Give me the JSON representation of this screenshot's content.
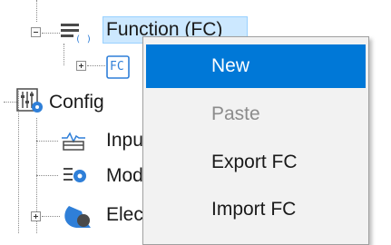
{
  "tree": {
    "function_fc": {
      "label": "Function (FC)",
      "expanded": true,
      "selected": true
    },
    "fc_child": {
      "icon_text": "FC",
      "expanded": false
    },
    "config": {
      "label": "Config",
      "expanded": true
    },
    "input_item": {
      "label": "Inpu"
    },
    "module_item": {
      "label": "Mod"
    },
    "electric_item": {
      "label": "Elec",
      "expanded": false
    }
  },
  "context_menu": {
    "items": [
      {
        "label": "New",
        "state": "highlighted"
      },
      {
        "label": "Paste",
        "state": "disabled"
      },
      {
        "label": "Export FC",
        "state": "normal"
      },
      {
        "label": "Import FC",
        "state": "normal"
      }
    ]
  },
  "colors": {
    "selection_bg": "#cce8ff",
    "menu_highlight": "#0078d7",
    "menu_bg": "#f2f2f2",
    "icon_blue": "#2f7fd8",
    "icon_dark": "#4a4a4a"
  }
}
